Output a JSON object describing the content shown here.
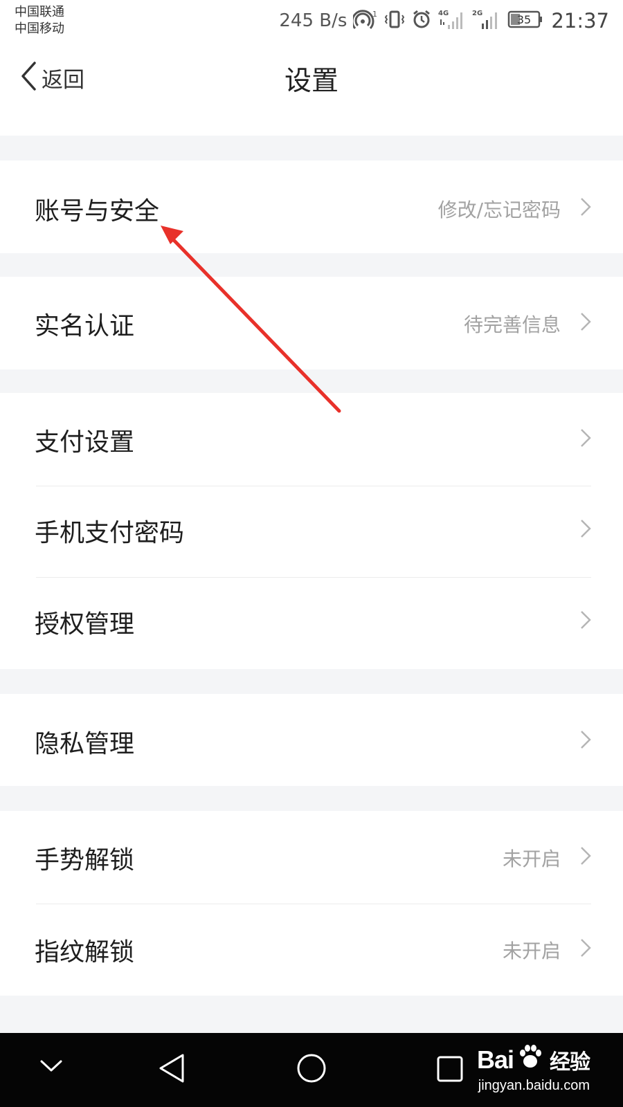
{
  "status_bar": {
    "carrier_1": "中国联通",
    "carrier_2": "中国移动",
    "net_speed": "245 B/s",
    "hotspot_superscript": "1",
    "network_1": "4G",
    "network_2": "2G",
    "battery_level": "35",
    "time": "21:37"
  },
  "nav": {
    "back_label": "返回",
    "title": "设置"
  },
  "settings": [
    {
      "label": "账号与安全",
      "value": "修改/忘记密码"
    },
    {
      "label": "实名认证",
      "value": "待完善信息"
    },
    {
      "label": "支付设置",
      "value": ""
    },
    {
      "label": "手机支付密码",
      "value": ""
    },
    {
      "label": "授权管理",
      "value": ""
    },
    {
      "label": "隐私管理",
      "value": ""
    },
    {
      "label": "手势解锁",
      "value": "未开启"
    },
    {
      "label": "指纹解锁",
      "value": "未开启"
    }
  ],
  "watermark": {
    "brand_left": "Bai",
    "brand_right": "经验",
    "url": "jingyan.baidu.com"
  },
  "colors": {
    "annotation_arrow": "#e8312a",
    "section_gap": "#f4f5f7",
    "value_text": "#a2a2a2"
  },
  "icons": {
    "back": "chevron-left-icon",
    "row_arrow": "chevron-right-icon",
    "sys_nav": [
      "chevron-down-icon",
      "triangle-back-icon",
      "circle-home-icon",
      "square-recent-icon"
    ]
  }
}
